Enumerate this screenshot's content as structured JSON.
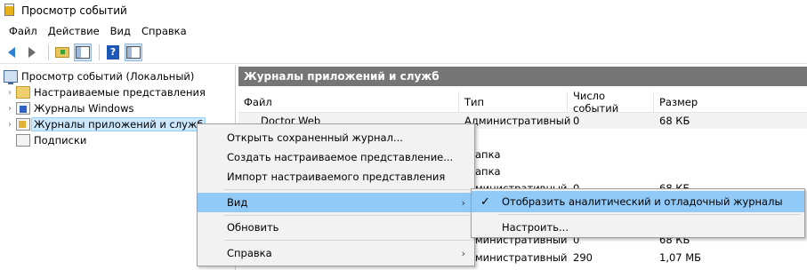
{
  "window": {
    "title": "Просмотр событий"
  },
  "menubar": {
    "items": [
      "Файл",
      "Действие",
      "Вид",
      "Справка"
    ]
  },
  "toolbar": {
    "icons": [
      "back-icon",
      "forward-icon",
      "folder-up-icon",
      "show-hide-tree-icon",
      "help-icon",
      "action-pane-icon"
    ]
  },
  "tree": {
    "root": "Просмотр событий (Локальный)",
    "items": [
      "Настраиваемые представления",
      "Журналы Windows",
      "Журналы приложений и служб",
      "Подписки"
    ]
  },
  "pane": {
    "header": "Журналы приложений и служб",
    "columns": [
      "Файл",
      "Тип",
      "Число событий",
      "Размер"
    ],
    "rows": [
      {
        "name": "Doctor Web",
        "type": "Административный",
        "count": "0",
        "size": "68 КБ"
      },
      {
        "name": "",
        "type": "апка",
        "count": "",
        "size": ""
      },
      {
        "name": "",
        "type": "апка",
        "count": "",
        "size": ""
      },
      {
        "name": "",
        "type": "министративный",
        "count": "0",
        "size": "68 КБ"
      },
      {
        "name": "",
        "type": "министративный",
        "count": "0",
        "size": "68 КБ"
      },
      {
        "name": "",
        "type": "министративный",
        "count": "290",
        "size": "1,07 МБ"
      }
    ]
  },
  "context_menu": {
    "items": [
      "Открыть сохраненный журнал...",
      "Создать настраиваемое представление...",
      "Импорт настраиваемого представления",
      "Вид",
      "Обновить",
      "Справка"
    ]
  },
  "submenu": {
    "items": [
      "Отобразить аналитический и отладочный журналы",
      "Настроить..."
    ]
  },
  "colors": {
    "highlight": "#91c9f7",
    "header_bar": "#757575"
  }
}
